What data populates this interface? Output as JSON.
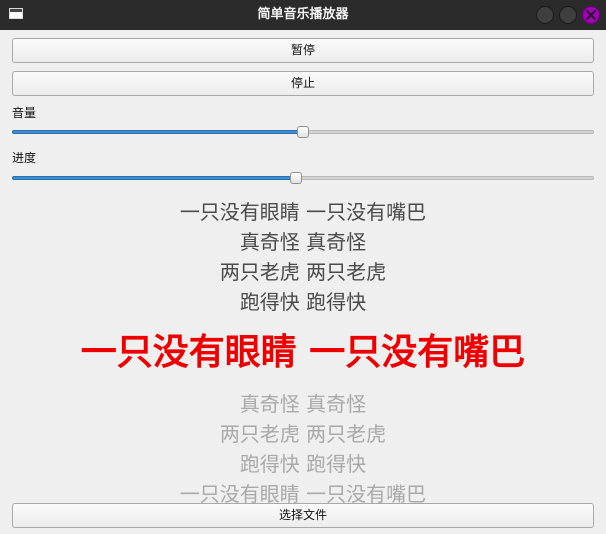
{
  "window": {
    "title": "简单音乐播放器",
    "close_color": "#a000b6"
  },
  "controls": {
    "pause_label": "暂停",
    "stop_label": "停止",
    "volume_label": "音量",
    "volume_value": 0.5,
    "progress_label": "进度",
    "progress_value": 0.487,
    "choose_file_label": "选择文件"
  },
  "lyrics": {
    "past": [
      "一只没有眼睛 一只没有嘴巴",
      "真奇怪 真奇怪",
      "两只老虎 两只老虎",
      "跑得快 跑得快"
    ],
    "current": "一只没有眼睛 一只没有嘴巴",
    "future": [
      "真奇怪 真奇怪",
      "两只老虎 两只老虎",
      "跑得快 跑得快",
      "一只没有眼睛 一只没有嘴巴"
    ],
    "current_color": "#ee0000"
  }
}
